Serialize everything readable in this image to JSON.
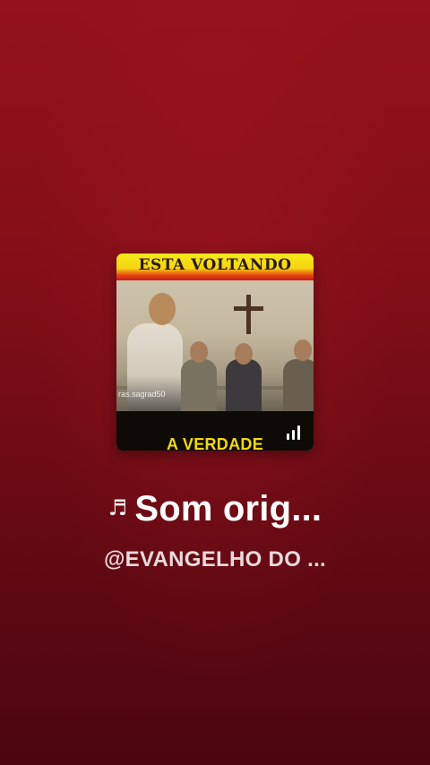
{
  "cover": {
    "headline": "ESTA VOLTANDO",
    "caption": "A VERDADE",
    "watermark": "ras.sagrad50",
    "indicator_icon": "audio-bars-icon",
    "colors": {
      "headline_band": "#f5d414",
      "caption_text": "#f4d80e"
    }
  },
  "sound": {
    "note_icon": "♬",
    "title": "Som orig...",
    "author": "@EVANGELHO DO ..."
  },
  "colors": {
    "background_top": "#94121a",
    "background_bottom": "#4c0610",
    "text": "#ffffff"
  }
}
